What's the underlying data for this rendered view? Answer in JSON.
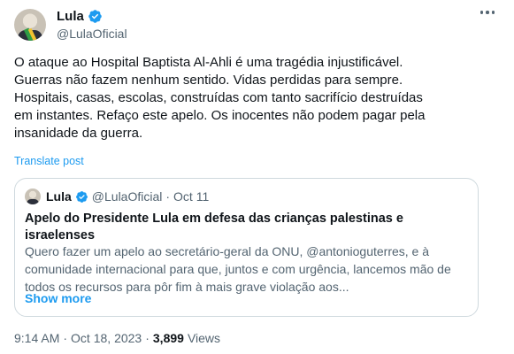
{
  "author": {
    "name": "Lula",
    "handle": "@LulaOficial"
  },
  "tweet": {
    "text": "O ataque ao Hospital Baptista Al-Ahli é uma tragédia injustificável.\nGuerras não fazem nenhum sentido. Vidas perdidas para sempre.\nHospitais, casas, escolas, construídas com tanto sacrifício destruídas\nem instantes. Refaço este apelo. Os inocentes não podem pagar pela\ninsanidade da guerra.",
    "translate_label": "Translate post"
  },
  "quote": {
    "name": "Lula",
    "handle": "@LulaOficial",
    "separator": "·",
    "date": "Oct 11",
    "title": "Apelo do Presidente Lula em defesa das crianças palestinas e israelenses",
    "body": "Quero fazer um apelo ao secretário-geral da ONU, @antonioguterres, e à\ncomunidade internacional para que, juntos e com urgência, lancemos mão de\ntodos os recursos para pôr fim à mais grave violação aos...",
    "show_more": "Show more"
  },
  "footer": {
    "time": "9:14 AM",
    "separator": "·",
    "date": "Oct 18, 2023",
    "views_count": "3,899",
    "views_label": "Views"
  },
  "icons": {
    "verified": "verified-badge-icon",
    "more": "more-options-icon"
  },
  "colors": {
    "accent": "#1d9bf0",
    "text": "#0f1419",
    "secondary": "#536471",
    "border": "#cfd9de"
  }
}
